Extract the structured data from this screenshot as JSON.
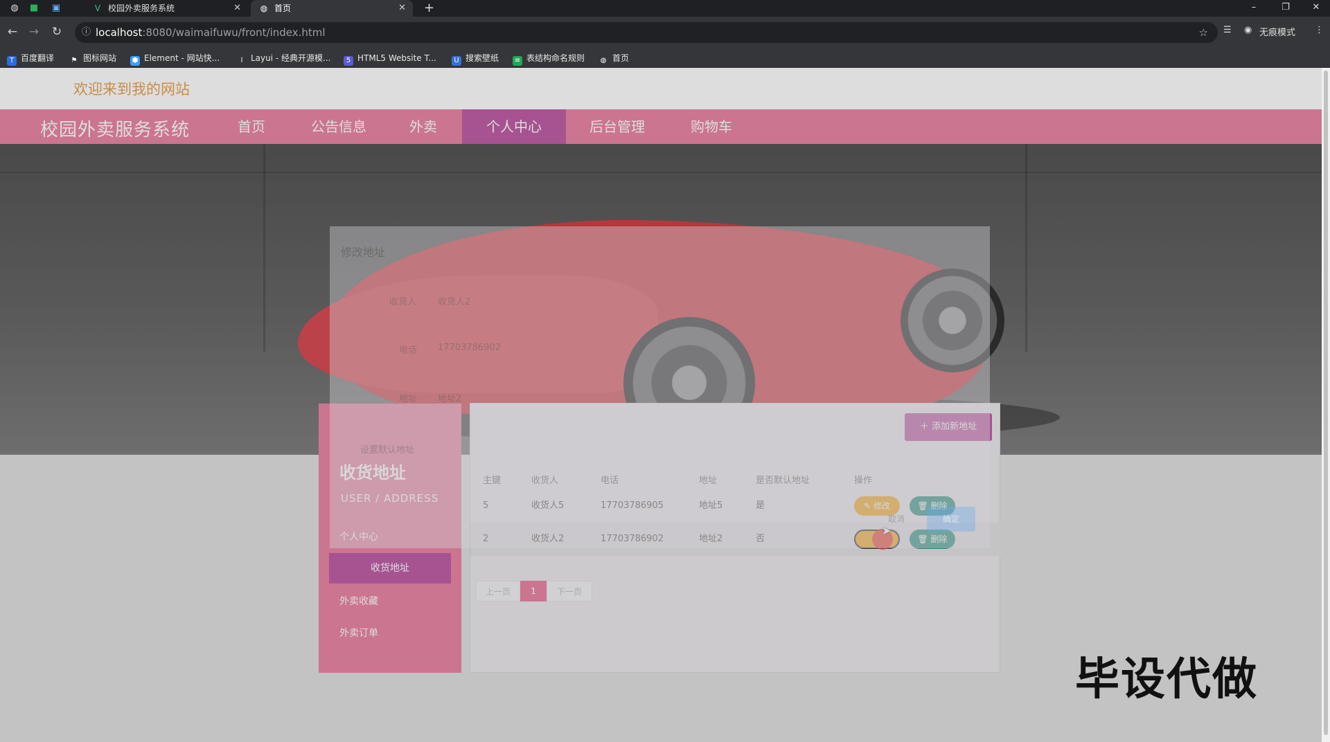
{
  "browser": {
    "tabs": [
      {
        "label": "校园外卖服务系统",
        "active": false
      },
      {
        "label": "首页",
        "active": true
      }
    ],
    "url_host": "localhost",
    "url_path": ":8080/waimaifuwu/front/index.html",
    "profile_label": "无痕模式",
    "bookmarks": [
      "百度翻译",
      "图标网站",
      "Element - 网站快...",
      "Layui - 经典开源模...",
      "HTML5 Website T...",
      "搜索壁纸",
      "表结构命名规则",
      "首页"
    ]
  },
  "site": {
    "welcome": "欢迎来到我的网站",
    "brand": "校园外卖服务系统",
    "nav": [
      "首页",
      "公告信息",
      "外卖",
      "个人中心",
      "后台管理",
      "购物车"
    ],
    "active_nav": "个人中心"
  },
  "sidebar": {
    "title": "收货地址",
    "subtitle": "USER / ADDRESS",
    "items": [
      "个人中心",
      "收货地址",
      "外卖收藏",
      "外卖订单"
    ],
    "active_item": "收货地址"
  },
  "address_table": {
    "add_button": "添加新地址",
    "columns": [
      "主键",
      "收货人",
      "电话",
      "地址",
      "是否默认地址",
      "操作"
    ],
    "rows": [
      {
        "id": "5",
        "receiver": "收货人5",
        "phone": "17703786905",
        "address": "地址5",
        "is_default": "是",
        "edit": "修改",
        "delete": "删除"
      },
      {
        "id": "2",
        "receiver": "收货人2",
        "phone": "17703786902",
        "address": "地址2",
        "is_default": "否",
        "edit": "",
        "delete": "删除"
      }
    ],
    "pager": {
      "prev": "上一页",
      "page": "1",
      "next": "下一页"
    }
  },
  "modal": {
    "title": "修改地址",
    "fields": [
      "收货人",
      "电话",
      "地址",
      "设置默认地址"
    ],
    "field_values": [
      "收货人2",
      "17703786902",
      "地址2"
    ],
    "cancel": "取消",
    "confirm": "确定"
  },
  "watermark": "毕设代做",
  "colors": {
    "accent": "#e77598",
    "active": "#b7479b",
    "edit": "#f0a20f",
    "delete": "#1a8876"
  }
}
